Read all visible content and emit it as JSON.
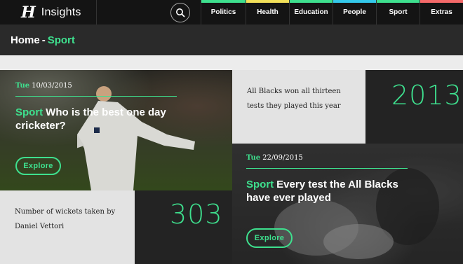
{
  "header": {
    "logo_mark": "H",
    "logo_text": "Insights",
    "search_icon": "search-icon",
    "nav": [
      {
        "label": "Politics",
        "color": "#3ee08e"
      },
      {
        "label": "Health",
        "color": "#f3e15a"
      },
      {
        "label": "Education",
        "color": "#3ee08e"
      },
      {
        "label": "People",
        "color": "#33c8ea"
      },
      {
        "label": "Sport",
        "color": "#3ee08e"
      },
      {
        "label": "Extras",
        "color": "#f56a6a"
      }
    ]
  },
  "breadcrumb": {
    "home": "Home",
    "separator": "-",
    "current": "Sport"
  },
  "cards": {
    "cricket": {
      "day": "Tue",
      "date": "10/03/2015",
      "tag": "Sport",
      "title": "Who is the best one day cricketer?",
      "button": "Explore"
    },
    "all_blacks": {
      "day": "Tue",
      "date": "22/09/2015",
      "tag": "Sport",
      "title": "Every test the All Blacks have ever played",
      "button": "Explore"
    }
  },
  "facts": {
    "wins": {
      "text_line1": "All Blacks won all thirteen",
      "text_line2": "tests they played this year",
      "number": "2013"
    },
    "wickets": {
      "text_line1": "Number of wickets taken by",
      "text_line2": "Daniel Vettori",
      "number": "303"
    }
  },
  "colors": {
    "accent": "#3ee08e",
    "dark": "#232323",
    "grey": "#e3e3e3"
  }
}
